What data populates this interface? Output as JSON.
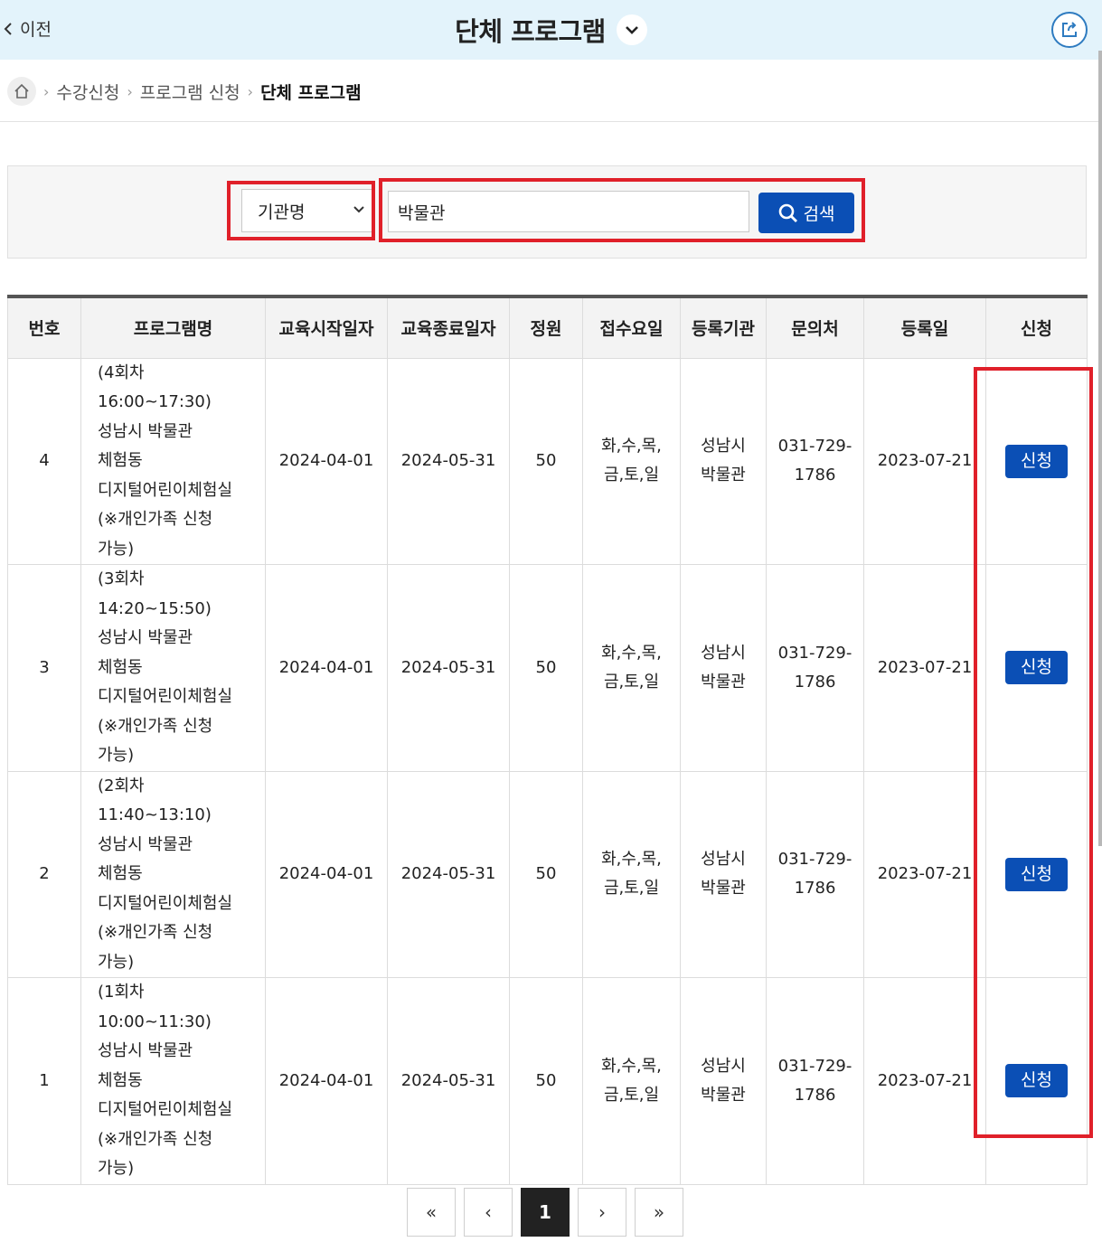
{
  "header": {
    "back_label": "이전",
    "title": "단체 프로그램",
    "icons": [
      "chevron-left-icon",
      "chevron-down-icon",
      "share-icon"
    ]
  },
  "breadcrumb": {
    "items": [
      "수강신청",
      "프로그램 신청"
    ],
    "current": "단체 프로그램"
  },
  "search": {
    "select_value": "기관명",
    "input_value": "박물관",
    "button_label": "검색"
  },
  "table": {
    "headers": [
      "번호",
      "프로그램명",
      "교육시작일자",
      "교육종료일자",
      "정원",
      "접수요일",
      "등록기관",
      "문의처",
      "등록일",
      "신청"
    ],
    "rows": [
      {
        "no": "4",
        "name_lines": [
          "(4회차 16:00~17:30)",
          "성남시 박물관",
          "체험동",
          "디지털어린이체험실",
          "(※개인가족 신청",
          "가능)"
        ],
        "start": "2024-04-01",
        "end": "2024-05-31",
        "capacity": "50",
        "days_lines": [
          "화,수,목,",
          "금,토,일"
        ],
        "org_lines": [
          "성남시",
          "박물관"
        ],
        "contact_lines": [
          "031-729-",
          "1786"
        ],
        "registered": "2023-07-21",
        "apply": "신청"
      },
      {
        "no": "3",
        "name_lines": [
          "(3회차 14:20~15:50)",
          "성남시 박물관",
          "체험동",
          "디지털어린이체험실",
          "(※개인가족 신청",
          "가능)"
        ],
        "start": "2024-04-01",
        "end": "2024-05-31",
        "capacity": "50",
        "days_lines": [
          "화,수,목,",
          "금,토,일"
        ],
        "org_lines": [
          "성남시",
          "박물관"
        ],
        "contact_lines": [
          "031-729-",
          "1786"
        ],
        "registered": "2023-07-21",
        "apply": "신청"
      },
      {
        "no": "2",
        "name_lines": [
          "(2회차 11:40~13:10)",
          "성남시 박물관",
          "체험동",
          "디지털어린이체험실",
          "(※개인가족 신청",
          "가능)"
        ],
        "start": "2024-04-01",
        "end": "2024-05-31",
        "capacity": "50",
        "days_lines": [
          "화,수,목,",
          "금,토,일"
        ],
        "org_lines": [
          "성남시",
          "박물관"
        ],
        "contact_lines": [
          "031-729-",
          "1786"
        ],
        "registered": "2023-07-21",
        "apply": "신청"
      },
      {
        "no": "1",
        "name_lines": [
          "(1회차 10:00~11:30)",
          "성남시 박물관",
          "체험동",
          "디지털어린이체험실",
          "(※개인가족 신청",
          "가능)"
        ],
        "start": "2024-04-01",
        "end": "2024-05-31",
        "capacity": "50",
        "days_lines": [
          "화,수,목,",
          "금,토,일"
        ],
        "org_lines": [
          "성남시",
          "박물관"
        ],
        "contact_lines": [
          "031-729-",
          "1786"
        ],
        "registered": "2023-07-21",
        "apply": "신청"
      }
    ]
  },
  "pagination": {
    "first": "«",
    "prev": "‹",
    "current_page": "1",
    "next": "›",
    "last": "»"
  },
  "colors": {
    "header_bg": "#e3f3fb",
    "primary_button": "#0b4fb5",
    "highlight_box": "#e0202a"
  }
}
